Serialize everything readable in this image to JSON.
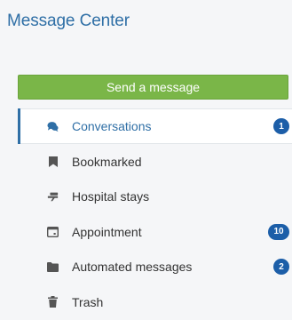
{
  "header": {
    "title": "Message Center"
  },
  "actions": {
    "send_label": "Send a message"
  },
  "nav": {
    "items": [
      {
        "label": "Conversations",
        "badge": "1",
        "icon": "chat-bubbles-icon",
        "active": true
      },
      {
        "label": "Bookmarked",
        "badge": "",
        "icon": "bookmark-icon",
        "active": false
      },
      {
        "label": "Hospital stays",
        "badge": "",
        "icon": "hospital-bed-icon",
        "active": false
      },
      {
        "label": "Appointment",
        "badge": "10",
        "icon": "calendar-icon",
        "active": false
      },
      {
        "label": "Automated messages",
        "badge": "2",
        "icon": "folder-icon",
        "active": false
      },
      {
        "label": "Trash",
        "badge": "",
        "icon": "trash-icon",
        "active": false
      }
    ]
  },
  "colors": {
    "accent": "#2f6fa6",
    "send_button": "#7ab648",
    "badge": "#1c5ea8",
    "icon": "#555555"
  }
}
